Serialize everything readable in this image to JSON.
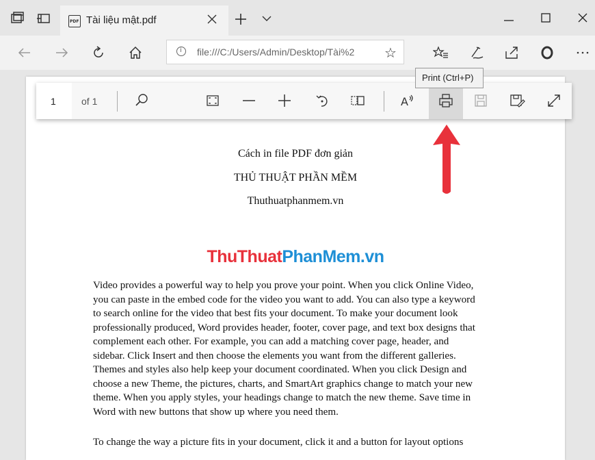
{
  "tab": {
    "title": "Tài liệu mật.pdf",
    "pdf_badge": "PDF"
  },
  "address": {
    "url": "file:///C:/Users/Admin/Desktop/Tài%2"
  },
  "pdf_toolbar": {
    "page_number": "1",
    "page_total": "of 1",
    "tooltip": "Print (Ctrl+P)"
  },
  "document": {
    "heading1": "Cách in file PDF đơn giản",
    "heading2": "THỦ THUẬT PHẦN MỀM",
    "heading3": "Thuthuatphanmem.vn",
    "brand_part1": "ThuThuat",
    "brand_part2": "PhanMem.vn",
    "brand_colors": {
      "part1": "#e8313b",
      "part2": "#1e8fd6"
    },
    "paragraph_lines": [
      "Video provides a powerful way to help you prove your point. When you click Online Video,",
      "you can paste in the embed code for the video you want to add. You can also type a keyword",
      "to search online for the video that best fits your document. To make your document look",
      "professionally produced, Word provides header, footer, cover page, and text box designs that",
      "complement each other. For example, you can add a matching cover page, header, and",
      "sidebar. Click Insert and then choose the elements you want from the different galleries.",
      "Themes and styles also help keep your document coordinated. When you click Design and",
      "choose a new Theme, the pictures, charts, and SmartArt graphics change to match your new",
      "theme. When you apply styles, your headings change to match the new theme. Save time in",
      "Word with new buttons that show up where you need them."
    ],
    "paragraph2_partial": "To change the way a picture fits in your document, click it and a button for layout options"
  },
  "icons": {
    "titlebar": [
      "tab-preview-icon",
      "set-aside-tabs-icon",
      "pdf-file-icon",
      "close-tab-icon",
      "new-tab-icon",
      "tab-list-icon",
      "minimize-icon",
      "maximize-icon",
      "close-window-icon"
    ],
    "navbar": [
      "back-icon",
      "forward-icon",
      "refresh-icon",
      "home-icon",
      "info-icon",
      "favorite-star-icon",
      "favorites-list-icon",
      "annotate-icon",
      "share-icon",
      "extension-icon",
      "more-icon"
    ],
    "pdf_toolbar": [
      "search-icon",
      "fit-page-icon",
      "zoom-out-icon",
      "zoom-in-icon",
      "rotate-icon",
      "layout-icon",
      "read-aloud-icon",
      "print-icon",
      "save-icon",
      "save-as-icon",
      "fullscreen-icon"
    ]
  },
  "accent": {
    "arrow": "#e8313b"
  }
}
